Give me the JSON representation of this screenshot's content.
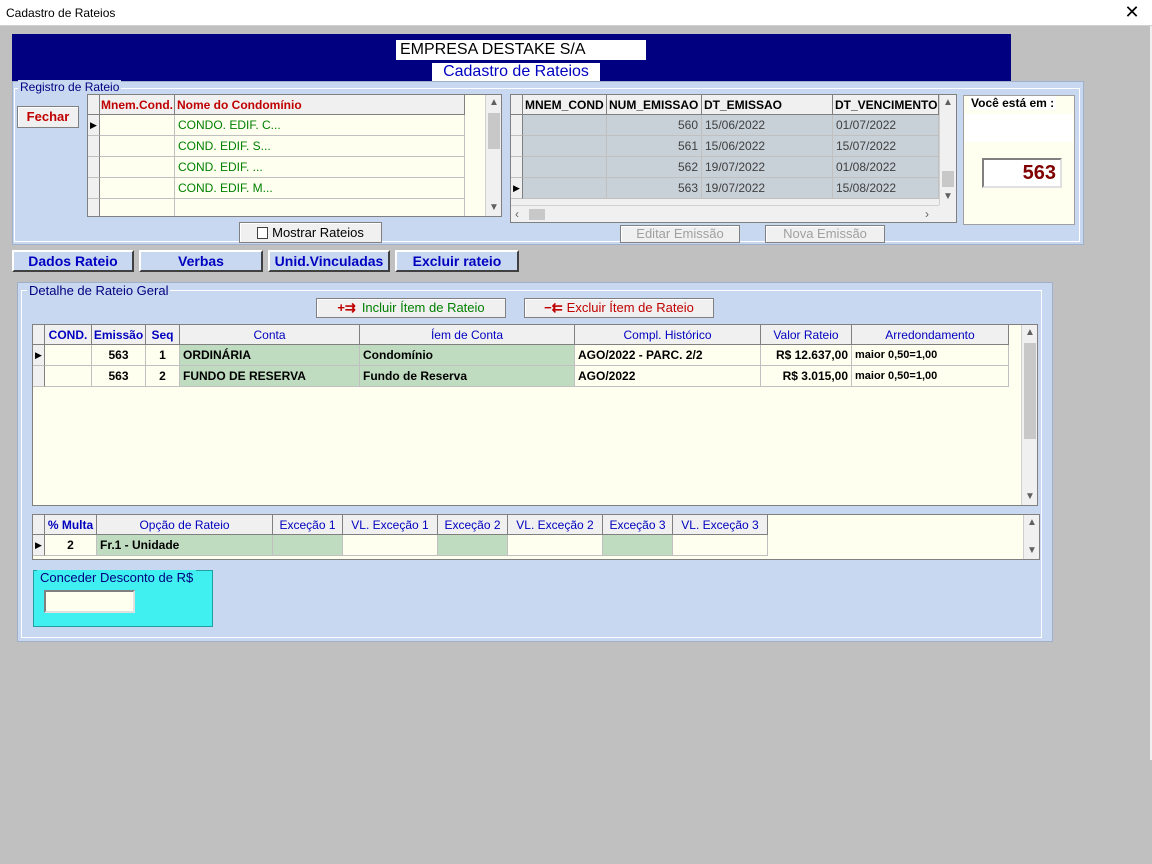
{
  "window": {
    "title": "Cadastro de Rateios",
    "close": "✕"
  },
  "header": {
    "company": "EMPRESA DESTAKE S/A",
    "screen_title": "Cadastro de Rateios"
  },
  "registro": {
    "legend": "Registro de Rateio",
    "fechar": "Fechar",
    "mostrar": "Mostrar Rateios",
    "condominios": {
      "headers": [
        "Mnem.Cond.",
        "Nome do Condomínio"
      ],
      "rows": [
        [
          "",
          "CONDO. EDIF. C..."
        ],
        [
          "",
          "COND. EDIF. S..."
        ],
        [
          "",
          "COND. EDIF. ..."
        ],
        [
          "",
          "COND. EDIF. M..."
        ],
        [
          "",
          ""
        ]
      ]
    },
    "emissoes": {
      "headers": [
        "MNEM_COND",
        "NUM_EMISSAO",
        "DT_EMISSAO",
        "DT_VENCIMENTO"
      ],
      "rows": [
        [
          "",
          "560",
          "15/06/2022",
          "01/07/2022"
        ],
        [
          "",
          "561",
          "15/06/2022",
          "15/07/2022"
        ],
        [
          "",
          "562",
          "19/07/2022",
          "01/08/2022"
        ],
        [
          "",
          "563",
          "19/07/2022",
          "15/08/2022"
        ]
      ]
    },
    "editar": "Editar Emissão",
    "nova": "Nova Emissão",
    "voce_esta_em": "Você está em :",
    "emissao_atual": "563"
  },
  "tabs": [
    "Dados Rateio",
    "Verbas",
    "Unid.Vinculadas",
    "Excluir rateio"
  ],
  "detalhe": {
    "legend": "Detalhe de Rateio Geral",
    "incluir": "Incluir Ítem de Rateio",
    "excluir": "Excluir Ítem de Rateio",
    "headers": [
      "COND.",
      "Emissão",
      "Seq",
      "Conta",
      "Íem de Conta",
      "Compl. Histórico",
      "Valor Rateio",
      "Arredondamento"
    ],
    "rows": [
      [
        "",
        "563",
        "1",
        "ORDINÁRIA",
        "Condomínio",
        "AGO/2022 - PARC. 2/2",
        "R$ 12.637,00",
        "maior 0,50=1,00"
      ],
      [
        "",
        "563",
        "2",
        "FUNDO DE RESERVA",
        "Fundo de Reserva",
        "AGO/2022",
        "R$ 3.015,00",
        "maior 0,50=1,00"
      ]
    ],
    "multa_headers": [
      "% Multa",
      "Opção de Rateio",
      "Exceção 1",
      "VL. Exceção 1",
      "Exceção 2",
      "VL. Exceção 2",
      "Exceção 3",
      "VL. Exceção 3"
    ],
    "multa_row": [
      "2",
      "Fr.1 - Unidade",
      "",
      "",
      "",
      "",
      "",
      ""
    ],
    "desconto_label": "Conceder Desconto de R$",
    "desconto_value": ""
  }
}
